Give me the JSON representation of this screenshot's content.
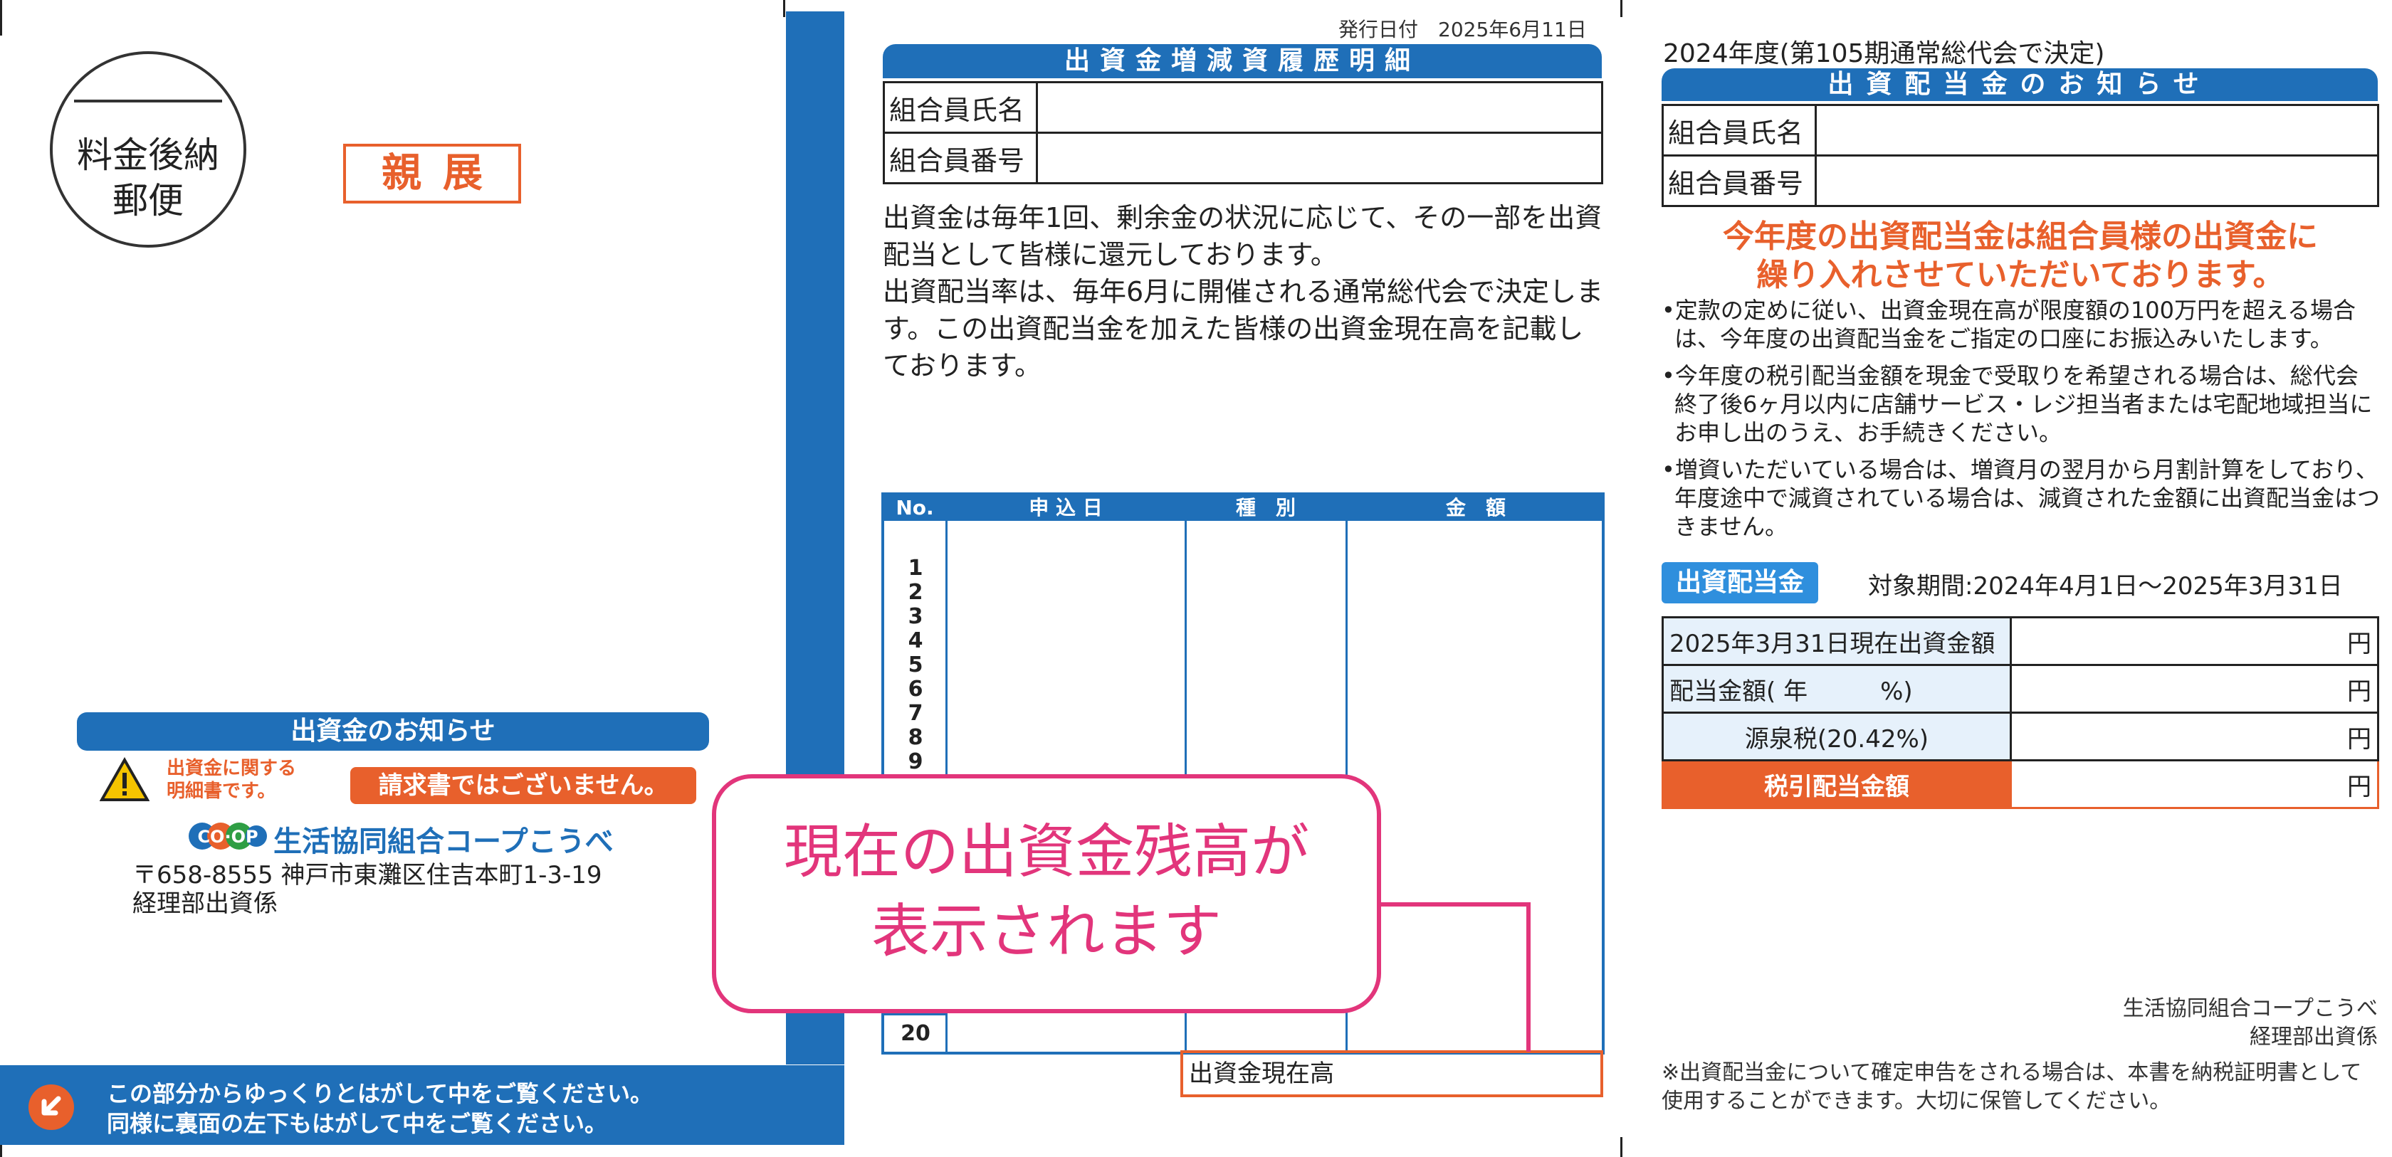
{
  "envelope": {
    "stamp": {
      "line1": "料金後納",
      "line2": "郵便"
    },
    "confidential": "親展",
    "notice_title": "出資金のお知らせ",
    "warning_line1": "出資金に関する",
    "warning_line2": "明細書です。",
    "not_invoice": "請求書ではございません。",
    "coop_logo": "CO·OP",
    "coop_name": "生活協同組合コープこうべ",
    "address_line1": "〒658-8555 神戸市東灘区住吉本町1-3-19",
    "address_line2": "経理部出資係",
    "peel_line1": "この部分からゆっくりとはがして中をご覧ください。",
    "peel_line2": "同様に裏面の左下もはがして中をご覧ください。"
  },
  "history": {
    "issue_date": "発行日付　2025年6月11日",
    "title": "出資金増減資履歴明細",
    "member_name_label": "組合員氏名",
    "member_no_label": "組合員番号",
    "desc_para1": "出資金は毎年1回、剰余金の状況に応じて、その一部を出資配当として皆様に還元しております。",
    "desc_para2": "出資配当率は、毎年6月に開催される通常総代会で決定します。この出資配当金を加えた皆様の出資金現在高を記載しております。",
    "table_headers": {
      "no": "No.",
      "date": "申 込 日",
      "type": "種　別",
      "amount": "金　額"
    },
    "row_numbers": "1\n2\n3\n4\n5\n6\n7\n8\n9",
    "last_row": "20",
    "balance_label": "出資金現在高",
    "callout_line1": "現在の出資金残高が",
    "callout_line2": "表示されます"
  },
  "dividend": {
    "fiscal_year": "2024年度(第105期通常総代会で決定)",
    "title": "出資配当金のお知らせ",
    "member_name_label": "組合員氏名",
    "member_no_label": "組合員番号",
    "headline_line1": "今年度の出資配当金は組合員様の出資金に",
    "headline_line2": "繰り入れさせていただいております。",
    "bullet1": "•定款の定めに従い、出資金現在高が限度額の100万円を超える場合は、今年度の出資配当金をご指定の口座にお振込みいたします。",
    "bullet2": "•今年度の税引配当金額を現金で受取りを希望される場合は、総代会終了後6ヶ月以内に店舗サービス・レジ担当者または宅配地域担当にお申し出のうえ、お手続きください。",
    "bullet3": "•増資いただいている場合は、増資月の翌月から月割計算をしており、年度途中で減資されている場合は、減資された金額に出資配当金はつきません。",
    "badge": "出資配当金",
    "period": "対象期間:2024年4月1日〜2025年3月31日",
    "row1_label": "2025年3月31日現在出資金額",
    "row2_label": "配当金額( 年　　　%)",
    "row3_label": "源泉税(20.42%)",
    "row4_label": "税引配当金額",
    "yen": "円",
    "issuer_line1": "生活協同組合コープこうべ",
    "issuer_line2": "経理部出資係",
    "footnote": "※出資配当金について確定申告をされる場合は、本書を納税証明書として使用することができます。大切に保管してください。"
  },
  "colors": {
    "blue": "#1f6fb8",
    "orange": "#e8602c",
    "pink": "#e2357b"
  }
}
